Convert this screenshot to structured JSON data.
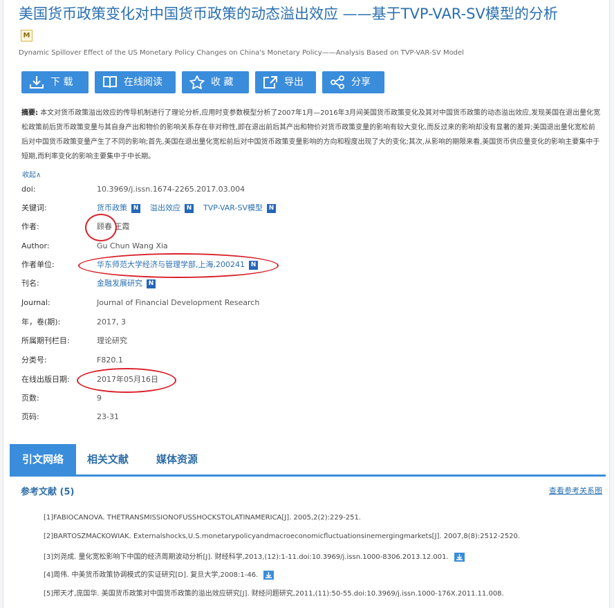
{
  "title": "美国货币政策变化对中国货币政策的动态溢出效应 ——基于TVP-VAR-SV模型的分析",
  "m_badge": "M",
  "subtitle": "Dynamic Spillover Effect of the US Monetary Policy Changes on China's Monetary Policy——Analysis Based on TVP-VAR-SV Model",
  "actions": [
    {
      "label": "下 载",
      "icon": "download-icon"
    },
    {
      "label": "在线阅读",
      "icon": "book-icon"
    },
    {
      "label": "收 藏",
      "icon": "star-icon"
    },
    {
      "label": "导出",
      "icon": "export-icon"
    },
    {
      "label": "分享",
      "icon": "share-icon"
    }
  ],
  "abstract": {
    "label": "摘要:",
    "text": "本文对货币政策溢出效应的传导机制进行了理论分析,应用时变参数模型分析了2007年1月—2016年3月间美国货币政策变化及其对中国货币政策的动态溢出效应,发现美国在退出量化宽松政策前后货币政策变量与其自身产出和物价的影响关系存在非对称性,即在退出前后其产出和物价对货币政策变量的影响有较大变化,而反过来的影响却没有显著的差异;美国退出量化宽松前后对中国货币政策变量产生了不同的影响;首先,美国在退出量化宽松前后对中国货币政策变量影响的方向和程度出现了大的变化;其次,从影响的期限来看,美国货币供应量变化的影响主要集中于短期,而利率变化的影响主要集中于中长期。",
    "collapse": "收起∧"
  },
  "meta": {
    "doi_label": "doi:",
    "doi": "10.3969/j.issn.1674-2265.2017.03.004",
    "keywords_label": "关键词:",
    "keywords": [
      "货币政策",
      "溢出效应",
      "TVP-VAR-SV模型"
    ],
    "authors_label": "作者:",
    "authors": "顾春 王霞",
    "author_en_label": "Author:",
    "author_en": "Gu Chun Wang Xia",
    "affil_label": "作者单位:",
    "affil": "华东师范大学经济与管理学部,上海,200241",
    "journal_label": "刊名:",
    "journal": "金融发展研究",
    "journal_en_label": "Journal:",
    "journal_en": "Journal of Financial Development Research",
    "year_label": "年，卷(期):",
    "year": "2017, 3",
    "column_label": "所属期刊栏目:",
    "column": "理论研究",
    "class_label": "分类号:",
    "class": "F820.1",
    "online_label": "在线出版日期:",
    "online": "2017年05月16日",
    "pages_label": "页数:",
    "pages": "9",
    "pagecode_label": "页码:",
    "pagecode": "23-31"
  },
  "tabs": [
    "引文网络",
    "相关文献",
    "媒体资源"
  ],
  "references": {
    "heading": "参考文献 (5)",
    "map_link": "查看参考关系图",
    "items": [
      "[1]FABIOCANOVA. THETRANSMISSIONOFUSSHOCKSTOLATINAMERICA[J]. 2005,2(2):229-251.",
      "[2]BARTOSZMACKOWIAK. Externalshocks,U.S.monetarypolicyandmacroeconomicfluctuationsinemergingmarkets[J]. 2007,8(8):2512-2520.",
      "[3]刘尧成. 量化宽松影响下中国的经济周期波动分析[J]. 财经科学,2013,(12):1-11.doi:10.3969/j.issn.1000-8306.2013.12.001.",
      "[4]周伟. 中美货币政策协调模式的实证研究[D]. 复旦大学,2008:1-46.",
      "[5]邢天才,庞国华. 美国货币政策对中国货币政策的溢出效应研究[J]. 财经问题研究,2011,(11):50-55.doi:10.3969/j.issn.1000-176X.2011.11.008."
    ]
  },
  "annotation_color": "#d8212a",
  "accent_color": "#3a8ddb"
}
